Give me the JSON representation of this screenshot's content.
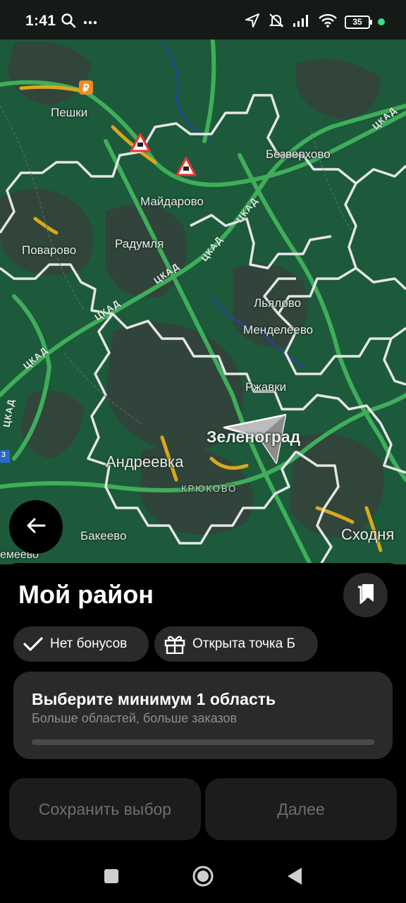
{
  "status_bar": {
    "time": "1:41",
    "battery": "35"
  },
  "map": {
    "places": {
      "peshki": "Пешки",
      "mayadarovo": "Майдарово",
      "bezverkhovo": "Безверхово",
      "povarovo": "Поварово",
      "radumlya": "Радумля",
      "lyalovo": "Льялово",
      "mendeleevo": "Менделеево",
      "rzhavki": "Ржавки",
      "zelenograd": "Зеленоград",
      "andreevka": "Андреевка",
      "kryukovo": "КРЮКОВО",
      "bakeevo": "Бакеево",
      "skhodnya": "Сходня",
      "sheremetevo": "емеево"
    },
    "road_label": "ЦКАД",
    "road_number": "3",
    "colors": {
      "map_base": "#1d5a3c",
      "hex_outline": "#e6e6e6",
      "road_green": "#3fae5a",
      "road_yellow": "#d9a81c"
    }
  },
  "sheet": {
    "title": "Мой район",
    "chips": {
      "no_bonus": "Нет бонусов",
      "point_b": "Открыта точка Б"
    },
    "card": {
      "title": "Выберите минимум 1 область",
      "subtitle": "Больше областей, больше заказов",
      "progress_fraction": 0
    },
    "buttons": {
      "save": "Сохранить выбор",
      "next": "Далее"
    }
  },
  "icons": {
    "status": [
      "search-icon",
      "more-icon",
      "location-arrow-icon",
      "mute-icon",
      "signal-icon",
      "wifi-icon",
      "battery-icon"
    ],
    "map": [
      "back-arrow-icon",
      "navigation-arrow-icon",
      "road-works-icon",
      "ruble-icon"
    ],
    "sheet": [
      "bookmark-icon",
      "check-icon",
      "gift-icon"
    ],
    "nav": [
      "recents-square-icon",
      "home-circle-icon",
      "back-triangle-icon"
    ]
  }
}
